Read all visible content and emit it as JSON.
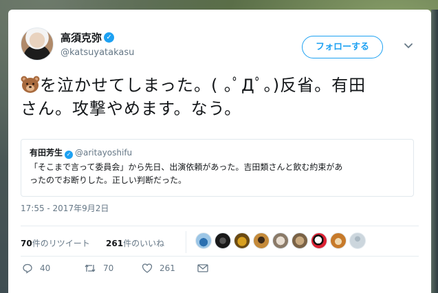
{
  "author": {
    "display_name": "高須克弥",
    "handle": "@katsuyatakasu"
  },
  "follow_button": {
    "label": "フォローする"
  },
  "tweet": {
    "text_line1": "を泣かせてしまった。( ｡ﾟДﾟ｡)反省。有田",
    "text_line2": "さん。攻撃やめます。なう。",
    "emoji": "bear-face-icon"
  },
  "quoted_tweet": {
    "display_name": "有田芳生",
    "handle": "@aritayoshifu",
    "text_line1": "「そこまで言って委員会」から先日、出演依頼があった。吉田類さんと飲む約束があ",
    "text_line2": "ったのでお断りした。正しい判断だった。"
  },
  "timestamp": "17:55 - 2017年9月2日",
  "stats": {
    "retweets_count": "70",
    "retweets_label": "件のリツイート",
    "likes_count": "261",
    "likes_label": "件のいいね"
  },
  "actions": {
    "reply_count": "40",
    "retweet_count": "70",
    "like_count": "261"
  },
  "colors": {
    "accent": "#1da1f2",
    "text": "#14171a",
    "secondary": "#657786",
    "border": "#e1e8ed"
  }
}
